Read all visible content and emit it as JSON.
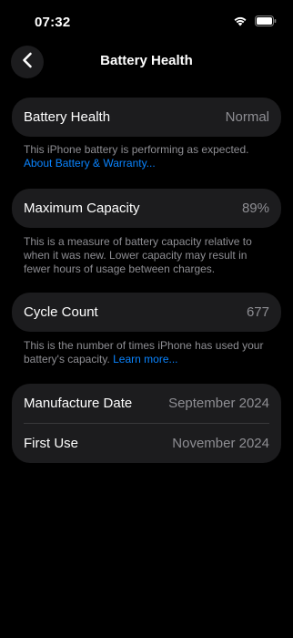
{
  "status_bar": {
    "time": "07:32"
  },
  "nav": {
    "title": "Battery Health"
  },
  "battery_health": {
    "label": "Battery Health",
    "value": "Normal",
    "note_text": "This iPhone battery is performing as expected.",
    "note_link": "About Battery & Warranty..."
  },
  "max_capacity": {
    "label": "Maximum Capacity",
    "value": "89%",
    "note_text": "This is a measure of battery capacity relative to when it was new. Lower capacity may result in fewer hours of usage between charges."
  },
  "cycle_count": {
    "label": "Cycle Count",
    "value": "677",
    "note_text": "This is the number of times iPhone has used your battery's capacity.",
    "note_link": "Learn more..."
  },
  "dates": {
    "manufacture_label": "Manufacture Date",
    "manufacture_value": "September 2024",
    "first_use_label": "First Use",
    "first_use_value": "November 2024"
  },
  "colors": {
    "background": "#000000",
    "card": "#1c1c1e",
    "secondary_text": "#8e8e93",
    "link": "#0a84ff"
  }
}
